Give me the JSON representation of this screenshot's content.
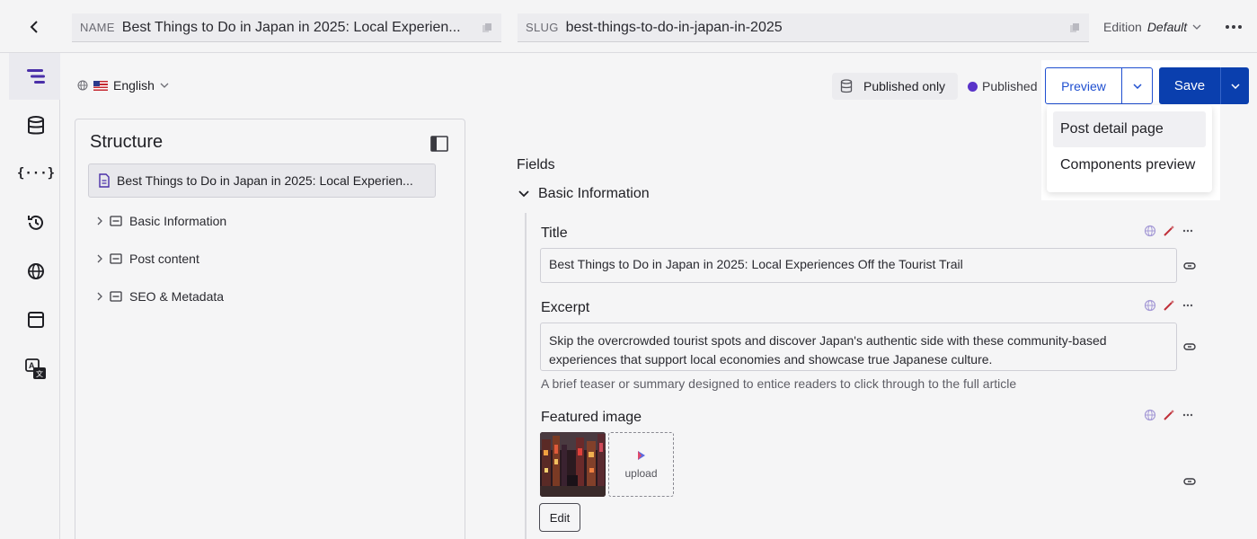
{
  "topbar": {
    "name_tag": "NAME",
    "name_value": "Best Things to Do in Japan in 2025: Local Experien...",
    "slug_tag": "SLUG",
    "slug_value": "best-things-to-do-in-japan-in-2025",
    "edition_label": "Edition",
    "edition_value": "Default"
  },
  "rail": {
    "items": [
      "structure-icon",
      "database-icon",
      "code-braces-icon",
      "history-icon",
      "globe-icon",
      "window-icon",
      "translate-icon"
    ]
  },
  "toolbar": {
    "language": "English",
    "published_only": "Published only",
    "status": "Published",
    "status_color": "#5a34c9",
    "preview_label": "Preview",
    "save_label": "Save",
    "accent": "#1f4fd0",
    "save_color": "#0a3fae"
  },
  "preview_menu": {
    "items": [
      {
        "label": "Post detail page"
      },
      {
        "label": "Components preview"
      }
    ]
  },
  "structure": {
    "title": "Structure",
    "root": "Best Things to Do in Japan in 2025: Local Experien...",
    "items": [
      {
        "label": "Basic Information"
      },
      {
        "label": "Post content"
      },
      {
        "label": "SEO & Metadata"
      }
    ]
  },
  "fields": {
    "heading": "Fields",
    "section": "Basic Information",
    "title_label": "Title",
    "title_value": "Best Things to Do in Japan in 2025: Local Experiences Off the Tourist Trail",
    "excerpt_label": "Excerpt",
    "excerpt_value": "Skip the overcrowded tourist spots and discover Japan's authentic side with these community-based experiences that support local economies and showcase true Japanese culture.",
    "excerpt_help": "A brief teaser or summary designed to entice readers to click through to the full article",
    "image_label": "Featured image",
    "upload_label": "upload",
    "edit_label": "Edit"
  }
}
